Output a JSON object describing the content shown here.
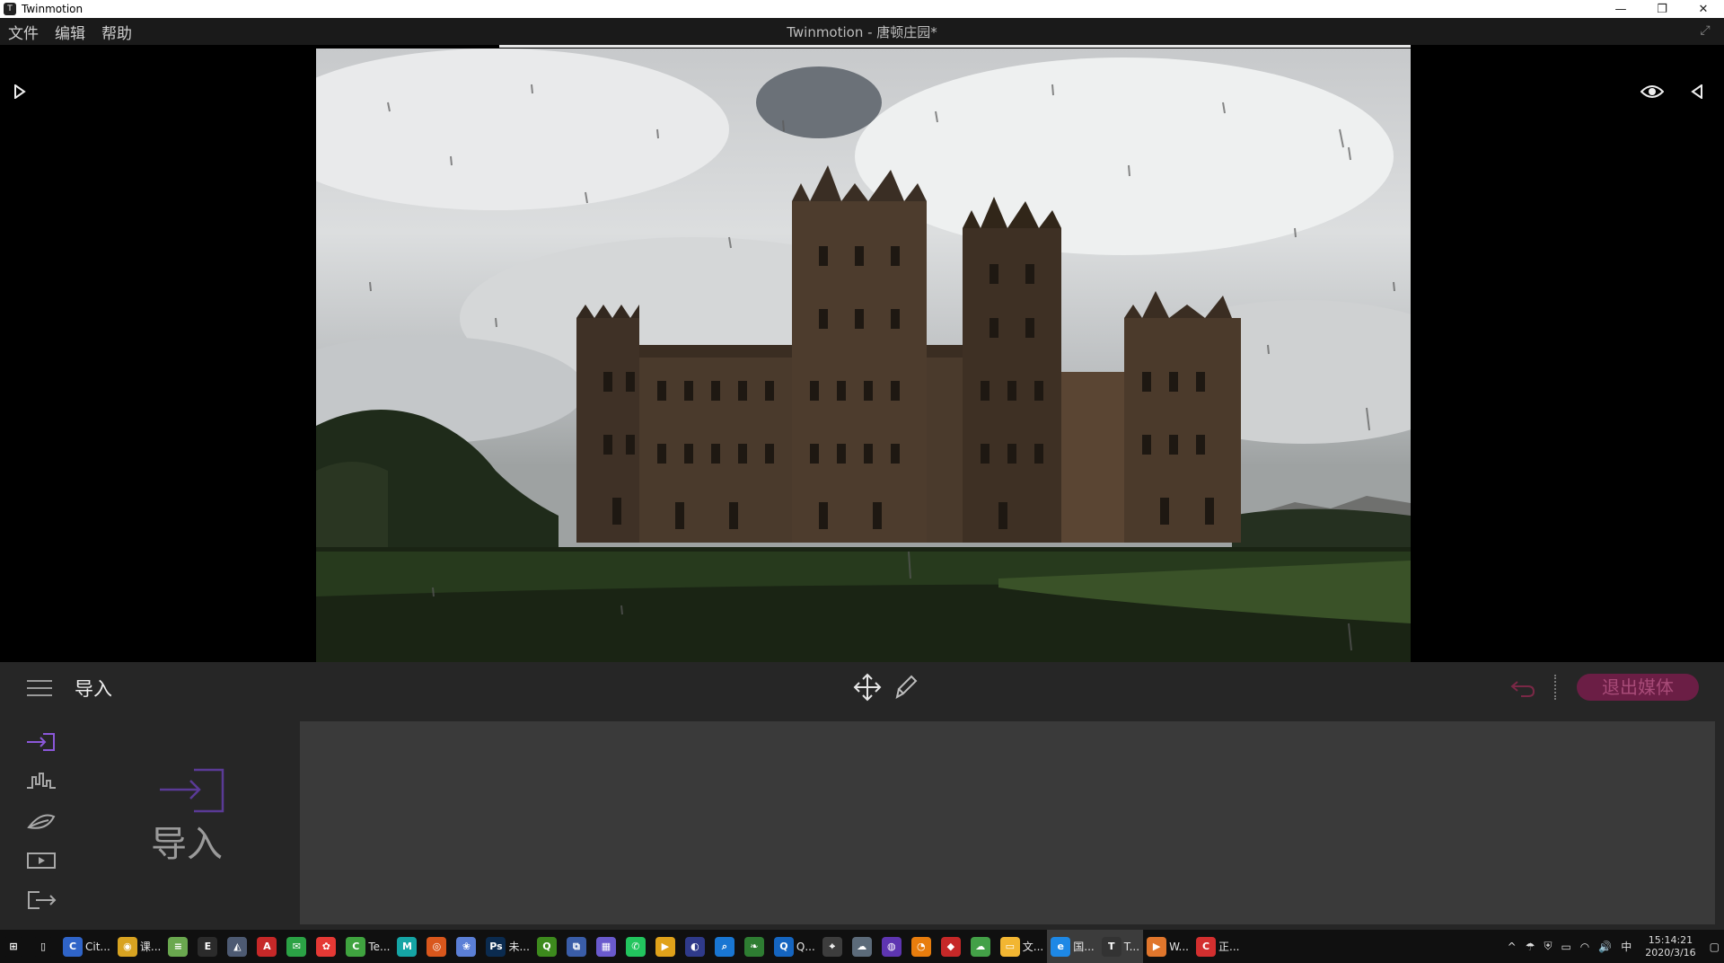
{
  "window": {
    "app_name": "Twinmotion",
    "controls": {
      "minimize": "—",
      "restore": "❐",
      "close": "✕"
    }
  },
  "menu": {
    "items": [
      "文件",
      "编辑",
      "帮助"
    ],
    "document_title": "Twinmotion - 唐顿庄园*"
  },
  "toolbar": {
    "section_title": "导入",
    "exit_media_label": "退出媒体"
  },
  "import_panel": {
    "tile_label": "导入",
    "side_tabs": [
      "import-tab-icon",
      "context-tab-icon",
      "environment-tab-icon",
      "media-tab-icon",
      "export-tab-icon"
    ]
  },
  "taskbar": {
    "items": [
      {
        "icon": "windows-start-icon",
        "label": "",
        "color": "#101010",
        "glyph": "⊞"
      },
      {
        "icon": "task-view-icon",
        "label": "",
        "color": "#101010",
        "glyph": "▯"
      },
      {
        "icon": "citrix-icon",
        "label": "Cit...",
        "color": "#2f64c8",
        "glyph": "C"
      },
      {
        "icon": "chrome-icon",
        "label": "课...",
        "color": "#d8a321",
        "glyph": "◉"
      },
      {
        "icon": "notepad-icon",
        "label": "",
        "color": "#6aa84f",
        "glyph": "≡"
      },
      {
        "icon": "epic-games-icon",
        "label": "",
        "color": "#2b2b2b",
        "glyph": "E"
      },
      {
        "icon": "sketch-icon",
        "label": "",
        "color": "#4d5a72",
        "glyph": "◭"
      },
      {
        "icon": "autocad-icon",
        "label": "",
        "color": "#c62828",
        "glyph": "A"
      },
      {
        "icon": "wechat-icon",
        "label": "",
        "color": "#2ba245",
        "glyph": "✉"
      },
      {
        "icon": "app-red-icon",
        "label": "",
        "color": "#e53935",
        "glyph": "✿"
      },
      {
        "icon": "camtasia-icon",
        "label": "Te...",
        "color": "#3fa33f",
        "glyph": "C"
      },
      {
        "icon": "maya-icon",
        "label": "",
        "color": "#15a5a5",
        "glyph": "M"
      },
      {
        "icon": "houdini-icon",
        "label": "",
        "color": "#d9571c",
        "glyph": "◎"
      },
      {
        "icon": "app-blue-icon",
        "label": "",
        "color": "#5b7fd6",
        "glyph": "❀"
      },
      {
        "icon": "photoshop-icon",
        "label": "未...",
        "color": "#0b2b4f",
        "glyph": "Ps"
      },
      {
        "icon": "qgis-icon",
        "label": "",
        "color": "#3d8a1d",
        "glyph": "Q"
      },
      {
        "icon": "network-icon",
        "label": "",
        "color": "#3a5da8",
        "glyph": "⧉"
      },
      {
        "icon": "app-purple-icon",
        "label": "",
        "color": "#6a5acd",
        "glyph": "▦"
      },
      {
        "icon": "line-icon",
        "label": "",
        "color": "#22c55e",
        "glyph": "✆"
      },
      {
        "icon": "media-player-icon",
        "label": "",
        "color": "#e0a21a",
        "glyph": "▶"
      },
      {
        "icon": "cinema4d-icon",
        "label": "",
        "color": "#2f3a8a",
        "glyph": "◐"
      },
      {
        "icon": "search-app-icon",
        "label": "",
        "color": "#1976d2",
        "glyph": "⌕"
      },
      {
        "icon": "leaf-app-icon",
        "label": "",
        "color": "#2e7d32",
        "glyph": "❧"
      },
      {
        "icon": "browser-q-icon",
        "label": "Q...",
        "color": "#1565c0",
        "glyph": "Q"
      },
      {
        "icon": "target-icon",
        "label": "",
        "color": "#3d3d3d",
        "glyph": "⌖"
      },
      {
        "icon": "cloud-compare-icon",
        "label": "",
        "color": "#5c6b7a",
        "glyph": "☁"
      },
      {
        "icon": "app-globe-icon",
        "label": "",
        "color": "#5e35b1",
        "glyph": "◍"
      },
      {
        "icon": "blender-icon",
        "label": "",
        "color": "#e87d0d",
        "glyph": "◔"
      },
      {
        "icon": "app-red2-icon",
        "label": "",
        "color": "#c62828",
        "glyph": "◆"
      },
      {
        "icon": "green-app-icon",
        "label": "",
        "color": "#43a047",
        "glyph": "☁"
      },
      {
        "icon": "file-explorer-icon",
        "label": "文...",
        "color": "#f2b632",
        "glyph": "▭"
      },
      {
        "icon": "ie-browser-icon",
        "label": "国...",
        "color": "#1e88e5",
        "glyph": "e",
        "active": true
      },
      {
        "icon": "twinmotion-task-icon",
        "label": "T...",
        "color": "#333333",
        "glyph": "T",
        "active": true
      },
      {
        "icon": "player-icon",
        "label": "W...",
        "color": "#e0762c",
        "glyph": "▶"
      },
      {
        "icon": "editor-red-icon",
        "label": "正...",
        "color": "#d32f2f",
        "glyph": "C"
      }
    ],
    "tray": [
      "^",
      "☂",
      "⛨",
      "▭",
      "◠",
      "🔊",
      "中"
    ],
    "time": "15:14:21",
    "date": "2020/3/16"
  }
}
